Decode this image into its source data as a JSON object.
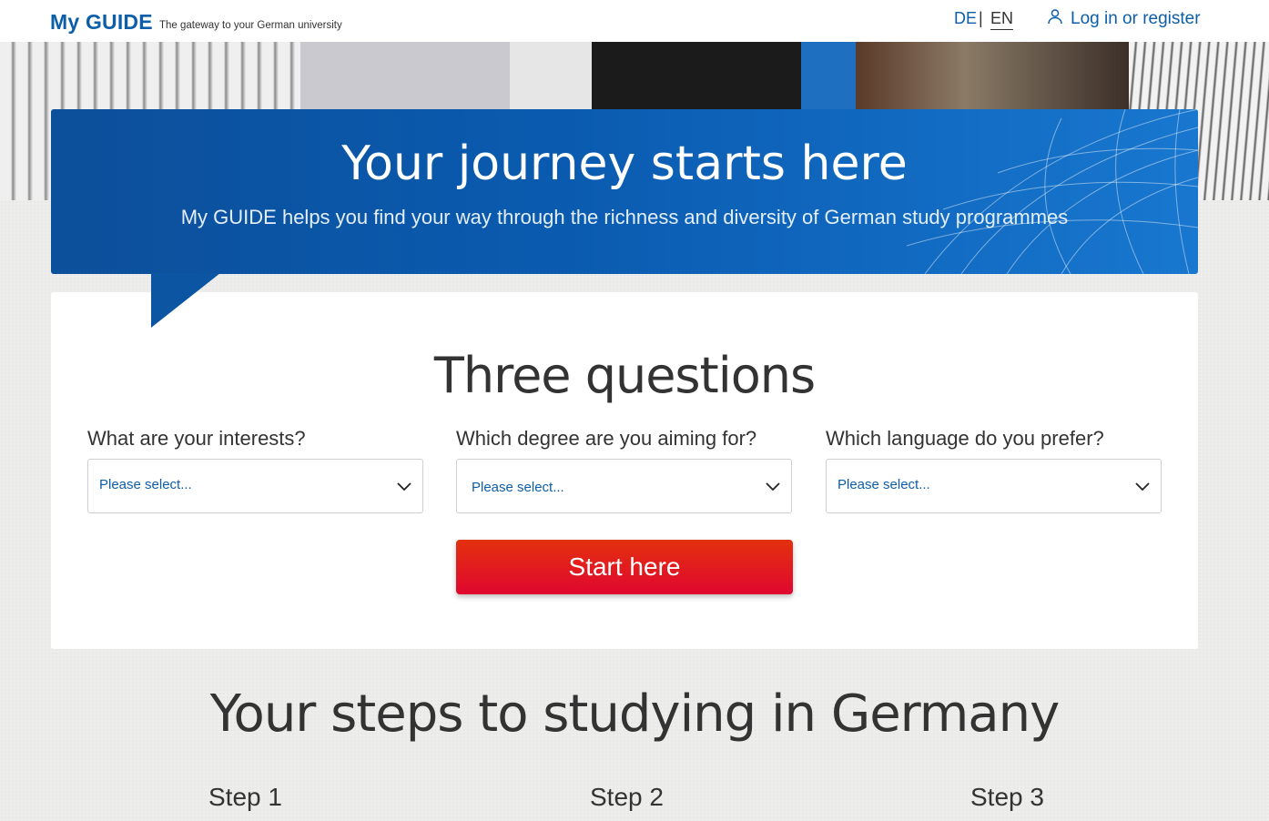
{
  "header": {
    "logo": "My GUIDE",
    "tagline": "The gateway to your German university",
    "lang_de": "DE",
    "lang_sep": "|",
    "lang_en": "EN",
    "login_label": "Log in or register"
  },
  "banner": {
    "title": "Your journey starts here",
    "subtitle": "My GUIDE helps you find your way through the richness and diversity of German study programmes"
  },
  "questions": {
    "title": "Three questions",
    "items": [
      {
        "label": "What are your interests?",
        "placeholder": "Please select..."
      },
      {
        "label": "Which degree are you aiming for?",
        "placeholder": "Please select..."
      },
      {
        "label": "Which language do you prefer?",
        "placeholder": "Please select..."
      }
    ],
    "start_label": "Start here"
  },
  "steps": {
    "title": "Your steps to studying in Germany",
    "items": [
      "Step 1",
      "Step 2",
      "Step 3"
    ]
  },
  "colors": {
    "brand_blue": "#0d5ea8",
    "banner_blue": "#0a5bb0",
    "cta_red": "#e0072f"
  },
  "icons": {
    "login": "user-icon",
    "select": "chevron-down-icon"
  }
}
